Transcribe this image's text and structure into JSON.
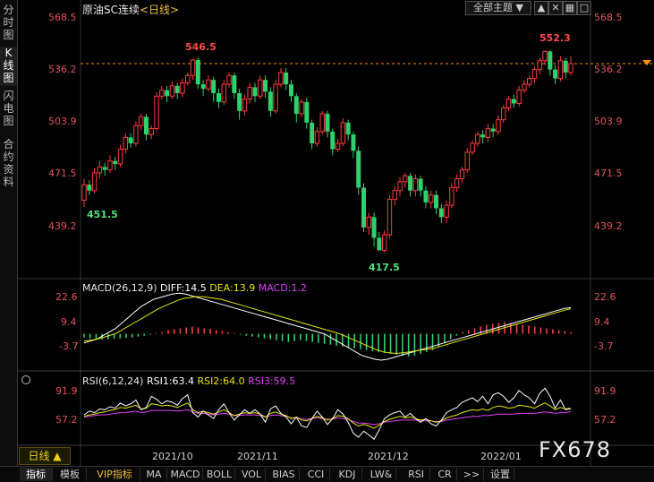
{
  "left_tabs": [
    "分\n时\n图",
    "K\n线\n图",
    "闪\n电\n图",
    "合\n约\n资\n料"
  ],
  "header": {
    "title": "原油SC连续",
    "period_tag": "<日线>",
    "theme_button": "全部主题",
    "icons": [
      "dropdown-icon",
      "up-arrow-icon",
      "close-box-icon",
      "grid-icon",
      "window-icon"
    ]
  },
  "colors": {
    "up": "#ff3b3b",
    "down": "#2ed16b",
    "axis_label": "#e0525a",
    "diff": "#ffffff",
    "dea": "#e6e600",
    "rsi3": "#e040fb",
    "dashed_line": "#ff8c00"
  },
  "price_panel": {
    "y_labels": [
      "568.5",
      "536.2",
      "503.9",
      "471.5",
      "439.2"
    ],
    "high_annotations": [
      "546.5",
      "552.3"
    ],
    "low_annotations": [
      "451.5",
      "417.5"
    ]
  },
  "macd_panel": {
    "legend": "MACD(26,12,9)",
    "diff": "DIFF:14.5",
    "dea": "DEA:13.9",
    "macd": "MACD:1.2",
    "y_labels": [
      "22.6",
      "9.4",
      "-3.7"
    ]
  },
  "rsi_panel": {
    "legend": "RSI(6,12,24)",
    "rsi1": "RSI1:63.4",
    "rsi2": "RSI2:64.0",
    "rsi3": "RSI3:59.5",
    "y_labels": [
      "91.9",
      "57.2"
    ]
  },
  "x_axis": {
    "labels": [
      "2021/10",
      "2021/11",
      "2021/12",
      "2022/01"
    ]
  },
  "period_button": "日线 ▲",
  "bottom_tabs": [
    "指标",
    "模板",
    "VIP指标",
    "MA",
    "MACD",
    "BOLL",
    "VOL",
    "BIAS",
    "CCI",
    "KDJ",
    "LW&",
    "RSI",
    "CR",
    ">>",
    "设置"
  ],
  "watermark": "FX678",
  "chart_data": {
    "type": "candlestick",
    "title": "原油SC连续",
    "ylim": [
      405,
      575
    ],
    "candles": [
      [
        451.5,
        462,
        447,
        466
      ],
      [
        462,
        458,
        455,
        465
      ],
      [
        458,
        470,
        456,
        473
      ],
      [
        470,
        474,
        466,
        478
      ],
      [
        474,
        472,
        468,
        477
      ],
      [
        472,
        478,
        470,
        482
      ],
      [
        478,
        476,
        472,
        481
      ],
      [
        476,
        486,
        474,
        489
      ],
      [
        486,
        494,
        483,
        497
      ],
      [
        494,
        490,
        487,
        497
      ],
      [
        490,
        502,
        488,
        505
      ],
      [
        502,
        508,
        499,
        510
      ],
      [
        508,
        496,
        492,
        510
      ],
      [
        496,
        500,
        493,
        502
      ],
      [
        500,
        522,
        498,
        525
      ],
      [
        522,
        526,
        520,
        529
      ],
      [
        526,
        522,
        518,
        529
      ],
      [
        522,
        529,
        520,
        532
      ],
      [
        529,
        524,
        520,
        531
      ],
      [
        524,
        531,
        521,
        534
      ],
      [
        531,
        536,
        529,
        538
      ],
      [
        536,
        546.5,
        533,
        547
      ],
      [
        546.5,
        530,
        527,
        548
      ],
      [
        530,
        527,
        522,
        533
      ],
      [
        527,
        533,
        525,
        536
      ],
      [
        533,
        524,
        518,
        535
      ],
      [
        524,
        518,
        514,
        527
      ],
      [
        518,
        530,
        516,
        533
      ],
      [
        530,
        536,
        528,
        538
      ],
      [
        536,
        524,
        520,
        538
      ],
      [
        524,
        512,
        506,
        527
      ],
      [
        512,
        520,
        509,
        523
      ],
      [
        520,
        528,
        517,
        531
      ],
      [
        528,
        522,
        518,
        531
      ],
      [
        522,
        533,
        520,
        536
      ],
      [
        533,
        525,
        521,
        536
      ],
      [
        525,
        512,
        508,
        528
      ],
      [
        512,
        530,
        510,
        533
      ],
      [
        530,
        538,
        528,
        541
      ],
      [
        538,
        530,
        526,
        541
      ],
      [
        530,
        522,
        518,
        533
      ],
      [
        522,
        510,
        504,
        524
      ],
      [
        510,
        518,
        508,
        520
      ],
      [
        518,
        504,
        500,
        521
      ],
      [
        504,
        490,
        486,
        506
      ],
      [
        490,
        498,
        488,
        501
      ],
      [
        498,
        510,
        496,
        512
      ],
      [
        510,
        498,
        494,
        512
      ],
      [
        498,
        486,
        482,
        500
      ],
      [
        486,
        490,
        484,
        493
      ],
      [
        490,
        504,
        488,
        507
      ],
      [
        504,
        496,
        492,
        506
      ],
      [
        496,
        485,
        480,
        498
      ],
      [
        485,
        460,
        455,
        488
      ],
      [
        460,
        433,
        430,
        463
      ],
      [
        433,
        440,
        428,
        443
      ],
      [
        440,
        426,
        420,
        443
      ],
      [
        426,
        417.5,
        417.5,
        430
      ],
      [
        417.5,
        428,
        416,
        431
      ],
      [
        428,
        452,
        426,
        455
      ],
      [
        452,
        458,
        448,
        461
      ],
      [
        458,
        464,
        454,
        467
      ],
      [
        464,
        468,
        460,
        470
      ],
      [
        468,
        458,
        454,
        470
      ],
      [
        458,
        466,
        454,
        469
      ],
      [
        466,
        458,
        454,
        468
      ],
      [
        458,
        450,
        446,
        461
      ],
      [
        450,
        455,
        446,
        458
      ],
      [
        455,
        446,
        442,
        458
      ],
      [
        446,
        440,
        436,
        449
      ],
      [
        440,
        448,
        436,
        451
      ],
      [
        448,
        460,
        446,
        463
      ],
      [
        460,
        466,
        457,
        469
      ],
      [
        466,
        472,
        463,
        474
      ],
      [
        472,
        484,
        470,
        487
      ],
      [
        484,
        490,
        482,
        492
      ],
      [
        490,
        496,
        488,
        498
      ],
      [
        496,
        494,
        490,
        499
      ],
      [
        494,
        500,
        491,
        503
      ],
      [
        500,
        498,
        494,
        503
      ],
      [
        498,
        506,
        496,
        509
      ],
      [
        506,
        514,
        504,
        516
      ],
      [
        514,
        520,
        512,
        522
      ],
      [
        520,
        517,
        514,
        523
      ],
      [
        517,
        526,
        515,
        529
      ],
      [
        526,
        530,
        524,
        533
      ],
      [
        530,
        534,
        528,
        536
      ],
      [
        534,
        540,
        531,
        542
      ],
      [
        540,
        546,
        537,
        548
      ],
      [
        546,
        552.3,
        543,
        553
      ],
      [
        552.3,
        540,
        536,
        553
      ],
      [
        540,
        534,
        530,
        543
      ],
      [
        534,
        546,
        532,
        549
      ],
      [
        546,
        538,
        534,
        548
      ],
      [
        538,
        544,
        536,
        549
      ]
    ],
    "macd": {
      "hist": [
        -2,
        -2.5,
        -3,
        -3.2,
        -3,
        -2.8,
        -2.5,
        -2.2,
        -2,
        -1.5,
        -1,
        -0.5,
        0.5,
        1,
        2,
        2.5,
        3,
        3.5,
        4,
        3.5,
        3,
        2.8,
        2,
        1.5,
        1,
        0.5,
        -0.5,
        -1,
        -1.5,
        -2,
        -2.5,
        -3,
        -3.5,
        -4,
        -4.5,
        -4,
        -3.5,
        -4,
        -4.5,
        -5,
        -5.5,
        -6,
        -6.5,
        -7,
        -7.5,
        -8,
        -8.5,
        -9,
        -9.5,
        -10,
        -10.5,
        -11,
        -11.5,
        -12,
        -12.5,
        -12,
        -11,
        -10,
        -9,
        -7,
        -5,
        -3,
        -1,
        1,
        2,
        3,
        4,
        5,
        5.5,
        6,
        6.5,
        6,
        5.5,
        5,
        4.5,
        4,
        3.5,
        3,
        2.5,
        2,
        1.5,
        1
      ],
      "diff": [
        -5,
        -4,
        -3,
        -1,
        1,
        3,
        6,
        9,
        12,
        15,
        17,
        19,
        20,
        21,
        22,
        22.4,
        22,
        21,
        20,
        19,
        18,
        17,
        16,
        15,
        14,
        13,
        12,
        11,
        10,
        9,
        8,
        7,
        6,
        5,
        4,
        3,
        2,
        1,
        0,
        -2,
        -4,
        -6,
        -8,
        -10,
        -12,
        -13,
        -14,
        -14.5,
        -14,
        -13,
        -12,
        -11,
        -10,
        -9,
        -8,
        -7,
        -6,
        -5,
        -4,
        -3,
        -2,
        -1,
        0,
        1,
        2,
        3,
        4,
        5,
        6,
        7,
        8,
        9,
        10,
        11,
        12,
        13,
        14,
        14.5
      ],
      "dea": [
        -4,
        -3.5,
        -3,
        -2,
        -1,
        0,
        2,
        4,
        6,
        8,
        10,
        12,
        14,
        15.5,
        17,
        18.5,
        19.5,
        20,
        20.5,
        20.5,
        20,
        19.5,
        19,
        18,
        17,
        16,
        15,
        14,
        13,
        12,
        11,
        10,
        9,
        8,
        7,
        6,
        5,
        4,
        3,
        2,
        1,
        0,
        -1.5,
        -3,
        -4.5,
        -6,
        -7.5,
        -9,
        -10,
        -10.5,
        -10.8,
        -10.5,
        -10,
        -9.5,
        -9,
        -8.5,
        -8,
        -7,
        -6,
        -5,
        -4,
        -3,
        -2,
        -1,
        0,
        1,
        2,
        3,
        4,
        5,
        6,
        7,
        8,
        9,
        10,
        11,
        12,
        13,
        13.9
      ]
    },
    "rsi": {
      "rsi1": [
        55,
        60,
        58,
        63,
        62,
        66,
        64,
        71,
        67,
        70,
        75,
        62,
        65,
        80,
        76,
        70,
        74,
        72,
        68,
        77,
        82,
        58,
        52,
        60,
        55,
        50,
        62,
        70,
        58,
        48,
        55,
        62,
        57,
        62,
        56,
        45,
        63,
        67,
        57,
        52,
        43,
        52,
        40,
        38,
        50,
        60,
        52,
        42,
        50,
        62,
        56,
        45,
        30,
        25,
        33,
        28,
        22,
        35,
        50,
        55,
        58,
        60,
        52,
        57,
        50,
        45,
        50,
        43,
        40,
        48,
        58,
        62,
        65,
        72,
        75,
        78,
        73,
        80,
        70,
        82,
        85,
        80,
        72,
        78,
        88,
        82,
        78,
        70,
        84,
        91,
        80,
        64,
        75,
        62,
        63.4
      ],
      "rsi2": [
        53,
        55,
        56,
        58,
        59,
        61,
        62,
        65,
        64,
        66,
        68,
        63,
        64,
        70,
        69,
        67,
        68,
        67,
        65,
        68,
        71,
        62,
        58,
        60,
        58,
        56,
        59,
        62,
        58,
        54,
        56,
        58,
        57,
        58,
        56,
        52,
        57,
        59,
        56,
        54,
        50,
        52,
        48,
        47,
        50,
        53,
        51,
        48,
        50,
        54,
        53,
        50,
        44,
        40,
        42,
        40,
        37,
        41,
        46,
        49,
        51,
        53,
        51,
        52,
        50,
        48,
        49,
        47,
        45,
        47,
        51,
        53,
        55,
        58,
        60,
        62,
        61,
        63,
        61,
        65,
        67,
        66,
        64,
        65,
        68,
        67,
        66,
        64,
        68,
        71,
        67,
        62,
        65,
        63,
        64.0
      ],
      "rsi3": [
        52,
        53,
        54,
        55,
        55,
        56,
        57,
        58,
        58,
        59,
        60,
        58,
        59,
        61,
        61,
        61,
        61,
        61,
        60,
        61,
        62,
        59,
        57,
        57,
        56,
        55,
        56,
        57,
        56,
        54,
        54,
        55,
        55,
        55,
        54,
        52,
        54,
        55,
        54,
        53,
        51,
        51,
        50,
        49,
        50,
        51,
        50,
        49,
        49,
        51,
        50,
        49,
        46,
        44,
        44,
        43,
        42,
        43,
        45,
        46,
        47,
        48,
        48,
        48,
        48,
        47,
        47,
        47,
        46,
        46,
        48,
        49,
        50,
        51,
        52,
        53,
        53,
        54,
        54,
        55,
        56,
        56,
        56,
        56,
        57,
        57,
        57,
        57,
        58,
        59,
        58,
        57,
        58,
        58,
        59.5
      ]
    }
  }
}
